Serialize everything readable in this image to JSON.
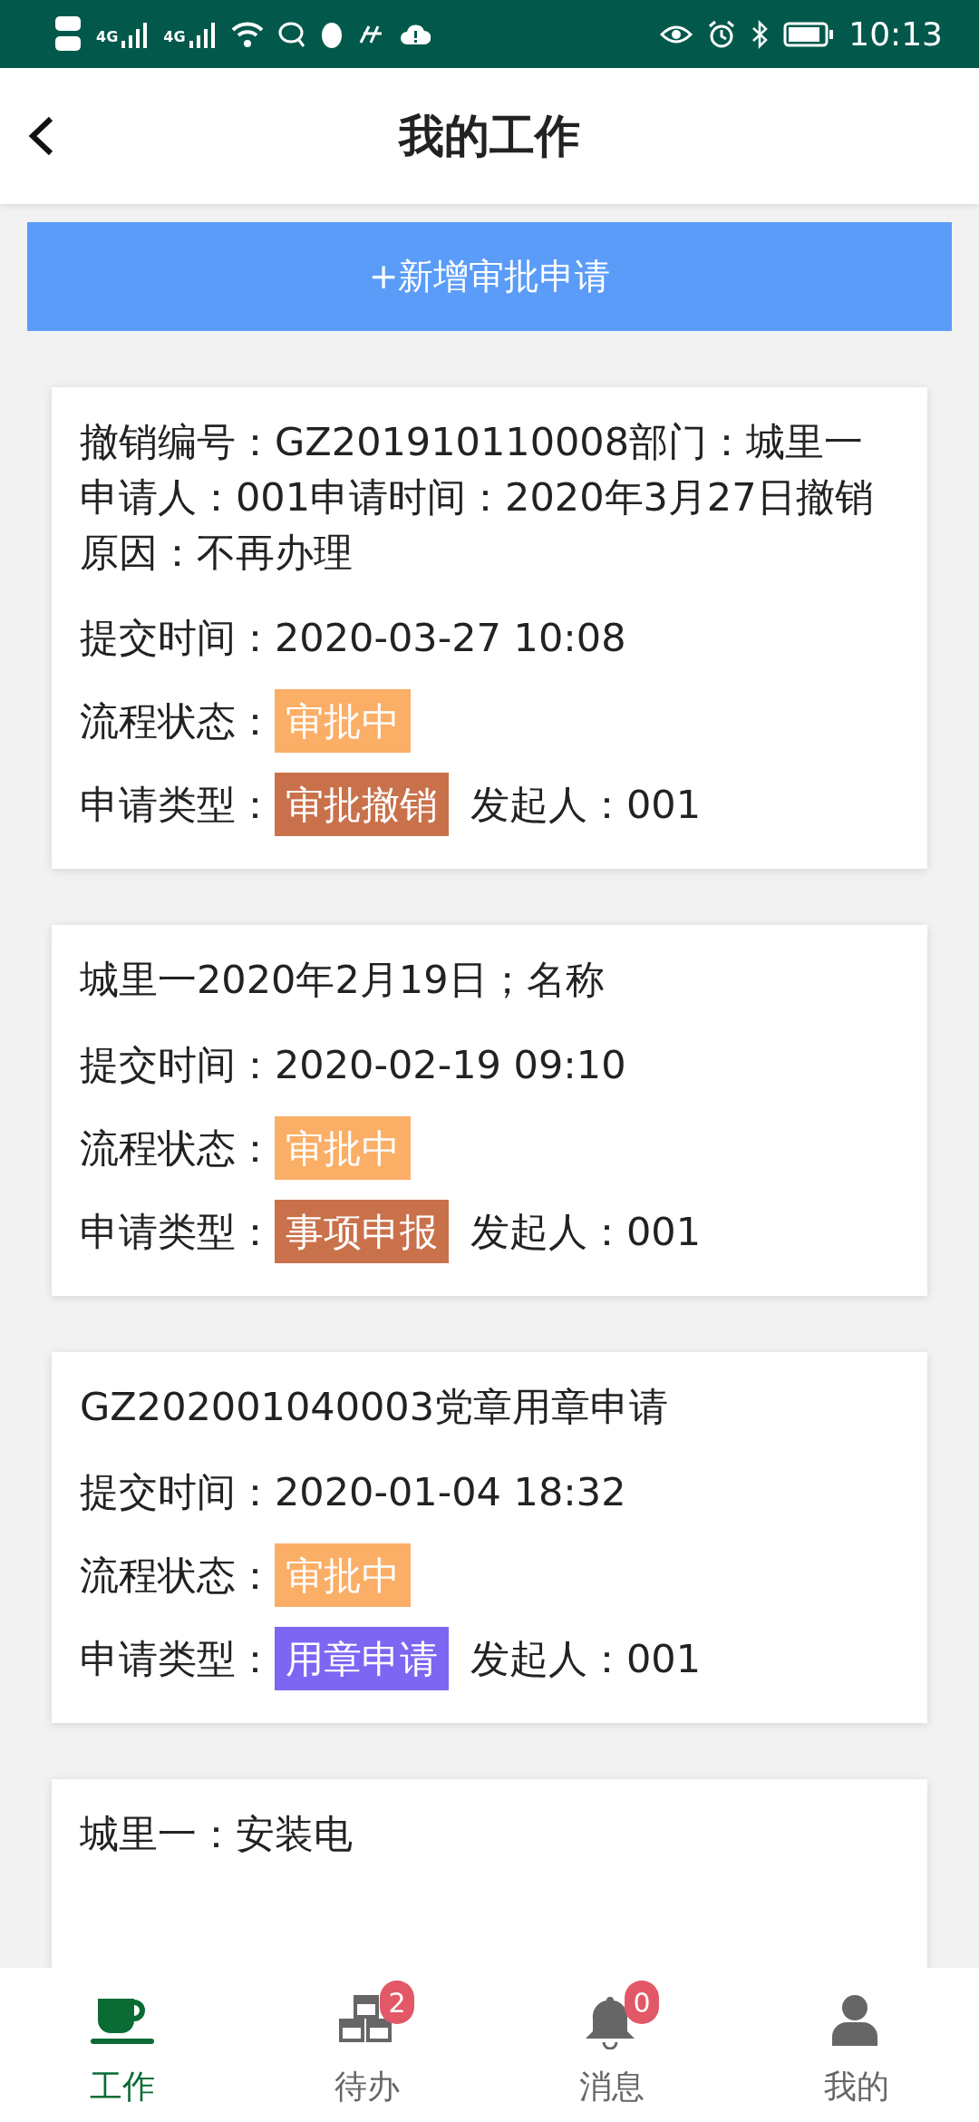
{
  "status_bar": {
    "network_labels": [
      "4G",
      "4G"
    ],
    "time": "10:13"
  },
  "header": {
    "title": "我的工作"
  },
  "add_button": "+新增审批申请",
  "cards": [
    {
      "title": "撤销编号：GZ201910110008部门：城里一申请人：001申请时间：2020年3月27日撤销原因：不再办理",
      "submitted_label": "提交时间：",
      "submitted": "2020-03-27 10:08",
      "status_label": "流程状态：",
      "status": {
        "text": "审批中",
        "color": "#fbae66"
      },
      "type_label": "申请类型：",
      "type": {
        "text": "审批撤销",
        "color": "#c9714b"
      },
      "initiator": "发起人：001"
    },
    {
      "title": "城里一2020年2月19日；名称",
      "submitted_label": "提交时间：",
      "submitted": "2020-02-19 09:10",
      "status_label": "流程状态：",
      "status": {
        "text": "审批中",
        "color": "#fbae66"
      },
      "type_label": "申请类型：",
      "type": {
        "text": "事项申报",
        "color": "#c9714b"
      },
      "initiator": "发起人：001"
    },
    {
      "title": "GZ202001040003党章用章申请",
      "submitted_label": "提交时间：",
      "submitted": "2020-01-04 18:32",
      "status_label": "流程状态：",
      "status": {
        "text": "审批中",
        "color": "#fbae66"
      },
      "type_label": "申请类型：",
      "type": {
        "text": "用章申请",
        "color": "#7c66f2"
      },
      "initiator": "发起人：001"
    },
    {
      "title": "城里一：安装电"
    }
  ],
  "tabbar": [
    {
      "kind": "cup",
      "label": "工作",
      "selected": true
    },
    {
      "kind": "boxes",
      "label": "待办",
      "selected": false,
      "badge": "2"
    },
    {
      "kind": "bell",
      "label": "消息",
      "selected": false,
      "badge": "0"
    },
    {
      "kind": "user",
      "label": "我的",
      "selected": false
    }
  ]
}
